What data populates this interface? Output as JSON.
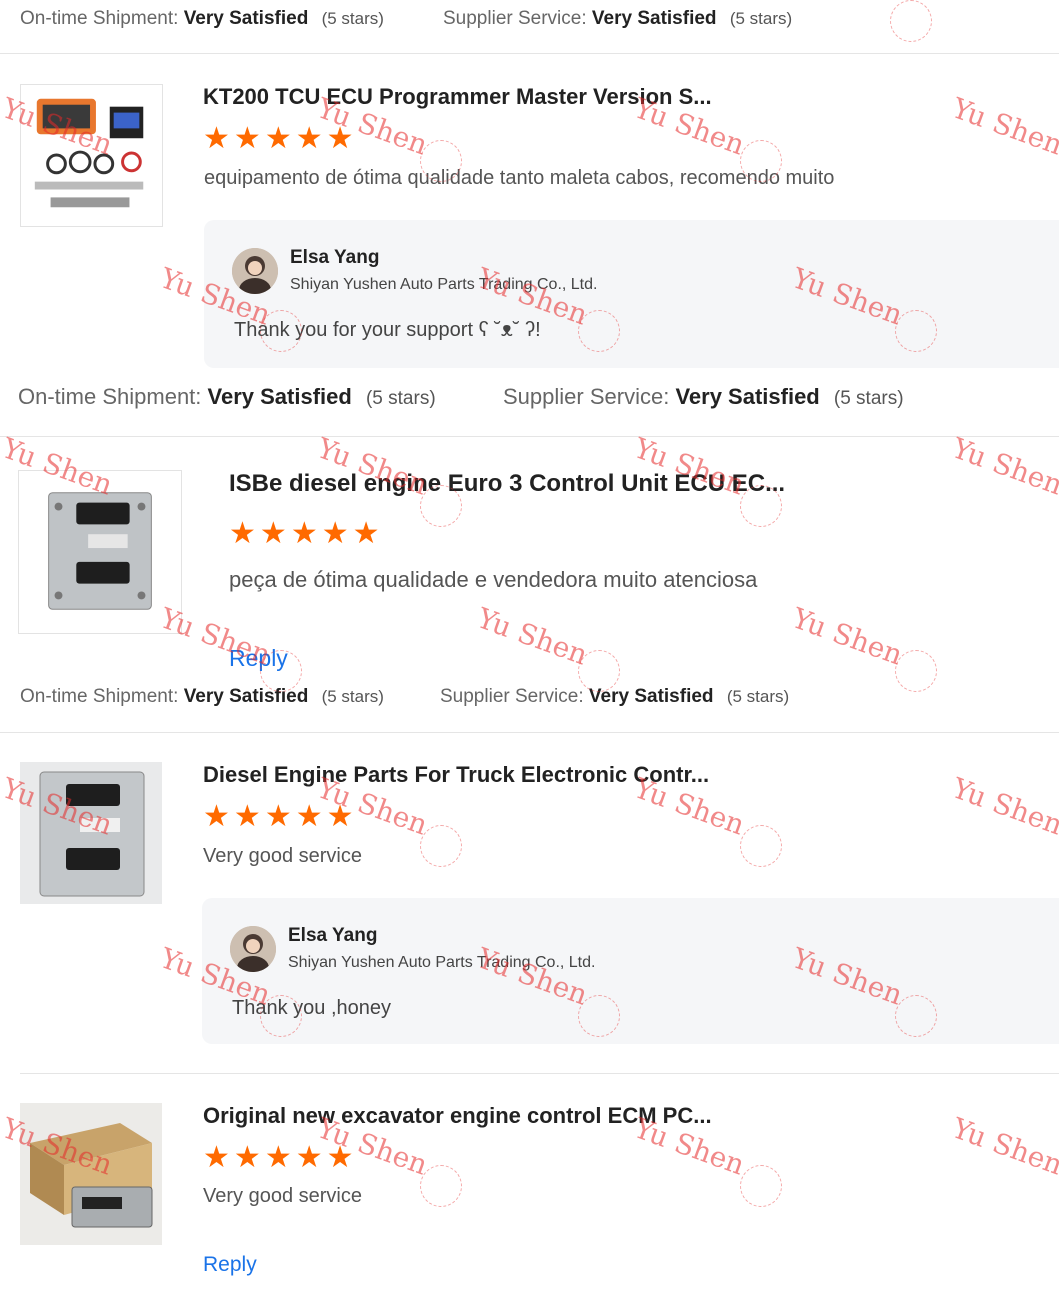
{
  "rating_labels": {
    "shipment": "On-time Shipment:",
    "service": "Supplier Service:",
    "value": "Very Satisfied",
    "stars": "(5 stars)"
  },
  "reviews": [
    {
      "title": "KT200 TCU ECU Programmer Master Version S...",
      "stars": 5,
      "comment": "equipamento de ótima qualidade tanto maleta cabos, recomendo muito",
      "reply": {
        "name": "Elsa Yang",
        "company": "Shiyan Yushen Auto Parts Trading Co., Ltd.",
        "text": "Thank you for your support ʕ ˘ᴥ˘ ʔ!"
      }
    },
    {
      "title": "ISBe diesel engine Euro 3 Control Unit ECU EC...",
      "stars": 5,
      "comment": "peça de ótima qualidade e vendedora muito atenciosa",
      "reply_link": "Reply"
    },
    {
      "title": "Diesel Engine Parts For Truck Electronic Contr...",
      "stars": 5,
      "comment": "Very good service",
      "reply": {
        "name": "Elsa Yang",
        "company": "Shiyan Yushen Auto Parts Trading Co., Ltd.",
        "text": "Thank you ,honey"
      }
    },
    {
      "title": "Original new excavator engine control ECM PC...",
      "stars": 5,
      "comment": "Very good service",
      "reply_link": "Reply"
    }
  ],
  "watermark": "Yu Shen",
  "colors": {
    "star": "#ff6a00",
    "link": "#1a73e8",
    "watermark": "#e62828"
  }
}
